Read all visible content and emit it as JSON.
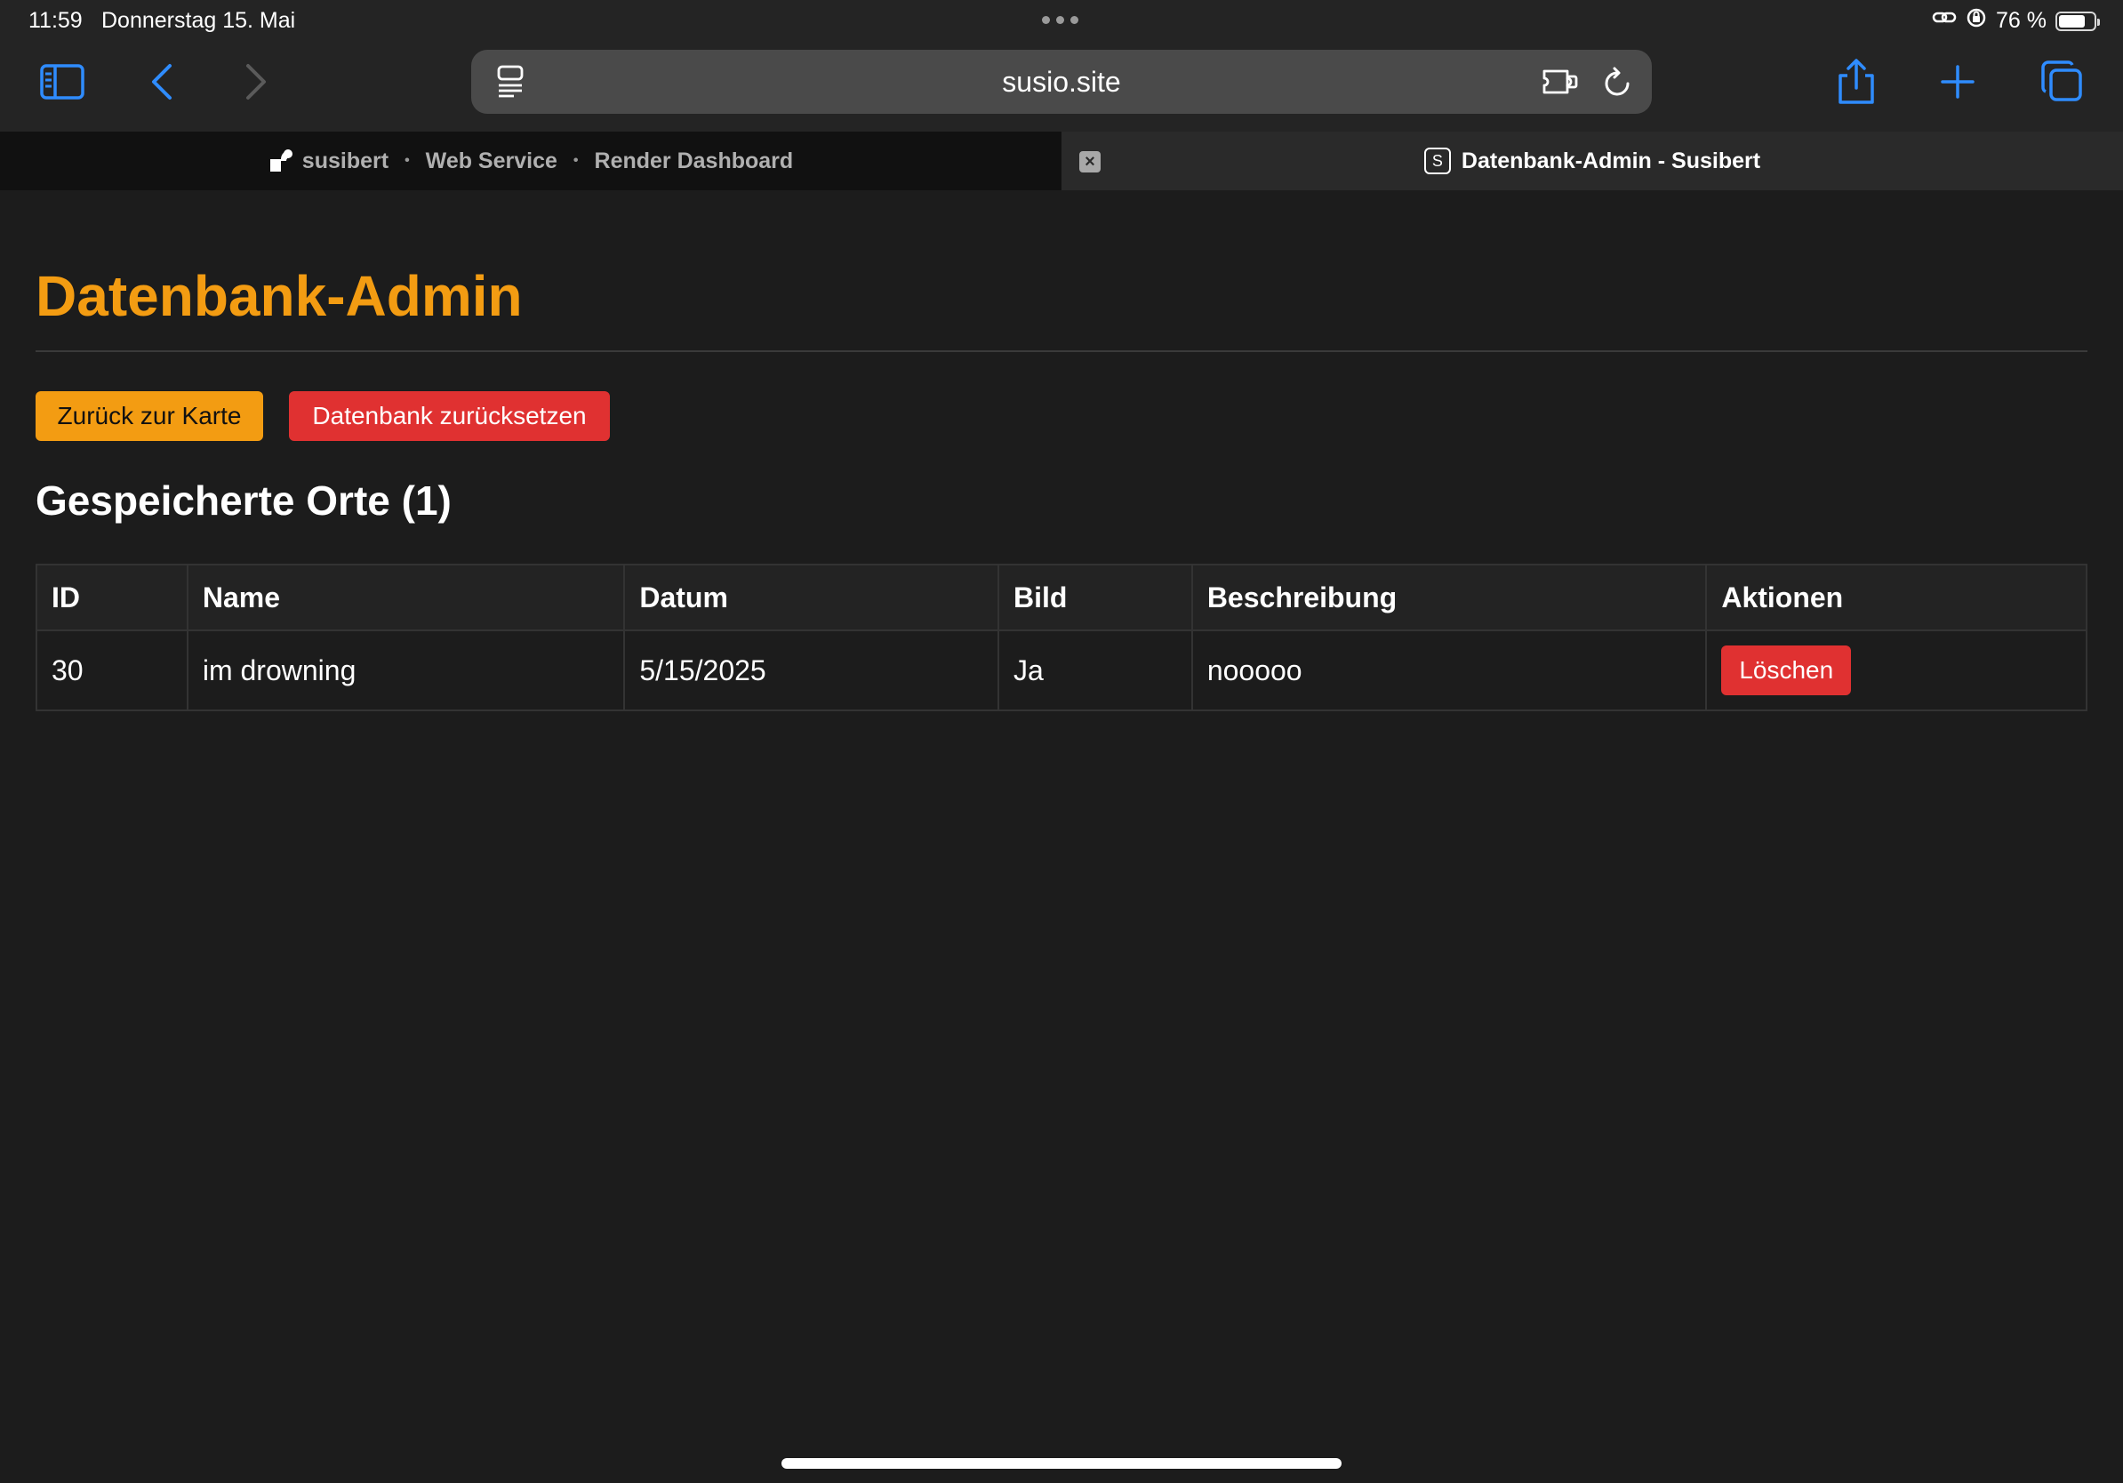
{
  "statusbar": {
    "time": "11:59",
    "date": "Donnerstag 15. Mai",
    "battery_text": "76 %",
    "battery_level": 0.76
  },
  "browser": {
    "url": "susio.site",
    "tabs": [
      {
        "parts": [
          "susibert",
          "Web Service",
          "Render Dashboard"
        ],
        "separator": "•",
        "active": false
      },
      {
        "favicon_letter": "S",
        "title": "Datenbank-Admin - Susibert",
        "active": true
      }
    ]
  },
  "page": {
    "title": "Datenbank-Admin",
    "buttons": {
      "back": "Zurück zur Karte",
      "reset": "Datenbank zurücksetzen"
    },
    "section_title": "Gespeicherte Orte (1)",
    "table": {
      "headers": [
        "ID",
        "Name",
        "Datum",
        "Bild",
        "Beschreibung",
        "Aktionen"
      ],
      "rows": [
        {
          "id": "30",
          "name": "im drowning",
          "date": "5/15/2025",
          "image": "Ja",
          "description": "nooooo",
          "action_label": "Löschen"
        }
      ]
    }
  },
  "colors": {
    "accent_orange": "#f39c12",
    "danger_red": "#e03131",
    "toolbar_blue": "#2f8cff",
    "background": "#1c1c1c"
  },
  "icons": [
    "sidebar-icon",
    "back-chevron-icon",
    "forward-chevron-icon",
    "reader-icon",
    "translate-icon",
    "reload-icon",
    "share-icon",
    "plus-icon",
    "tabs-icon",
    "render-logo-icon",
    "close-tab-icon",
    "link-icon",
    "orientation-lock-icon",
    "battery-icon"
  ]
}
